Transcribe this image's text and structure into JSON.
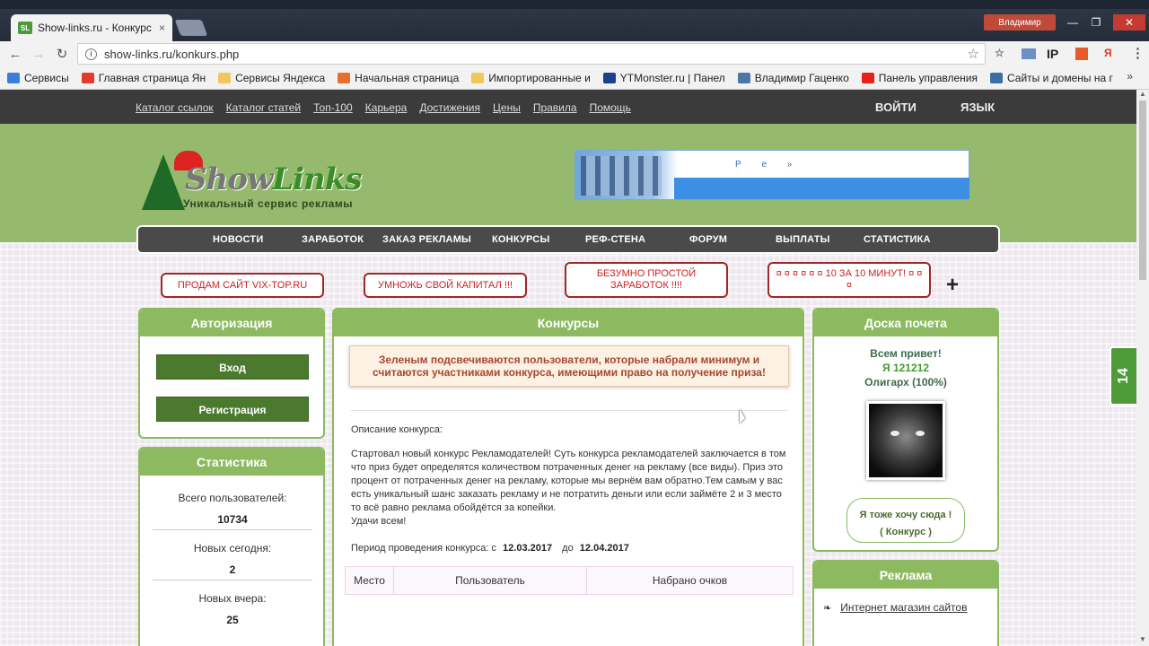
{
  "browser": {
    "tab_title": "Show-links.ru - Конкурс",
    "tab_favicon": "SL",
    "tab_close": "×",
    "user_name": "Владимир",
    "win_min": "—",
    "win_max": "❐",
    "win_close": "✕",
    "url": "show-links.ru/konkurs.php",
    "info_glyph": "i",
    "star_glyph": "☆",
    "back_glyph": "←",
    "forward_glyph": "→",
    "reload_glyph": "↻",
    "ext_ip": "IP",
    "ext_ya": "Я",
    "menu_glyph": "⋮",
    "bookmarks": [
      {
        "label": "Сервисы",
        "icon": "apps-icon",
        "color": "#3b7ddd"
      },
      {
        "label": "Главная страница Ян",
        "icon": "yandex-icon",
        "color": "#e03b2e"
      },
      {
        "label": "Сервисы Яндекса",
        "icon": "folder-icon",
        "color": "#f1c75b"
      },
      {
        "label": "Начальная страница",
        "icon": "firefox-icon",
        "color": "#e4702d"
      },
      {
        "label": "Импортированные и",
        "icon": "folder-icon",
        "color": "#f1c75b"
      },
      {
        "label": "YTMonster.ru | Панел",
        "icon": "ytmonster-icon",
        "color": "#1d3f8f"
      },
      {
        "label": "Владимир Гаценко",
        "icon": "vk-icon",
        "color": "#4a76a8"
      },
      {
        "label": "Панель управления",
        "icon": "youtube-icon",
        "color": "#e62117"
      },
      {
        "label": "Сайты и домены на г",
        "icon": "site-icon",
        "color": "#3a6ea5"
      }
    ],
    "bookmarks_more": "»"
  },
  "topnav": {
    "links": [
      "Каталог ссылок",
      "Каталог статей",
      "Топ-100",
      "Карьера",
      "Достижения",
      "Цены",
      "Правила",
      "Помощь"
    ],
    "login": "ВОЙТИ",
    "language": "ЯЗЫК"
  },
  "logo": {
    "name_a": "Show",
    "name_b": "Links",
    "tagline": "Уникальный сервис рекламы"
  },
  "banner": {
    "text": "Р е »"
  },
  "mainnav": [
    "НОВОСТИ",
    "ЗАРАБОТОК",
    "ЗАКАЗ РЕКЛАМЫ",
    "КОНКУРСЫ",
    "РЕФ-СТЕНА",
    "ФОРУМ",
    "ВЫПЛАТЫ",
    "СТАТИСТИКА"
  ],
  "promos": [
    "ПРОДАМ САЙТ VIX-TOP.RU",
    "УМНОЖЬ СВОЙ КАПИТАЛ !!!",
    "БЕЗУМНО ПРОСТОЙ ЗАРАБОТОК !!!!",
    "¤ ¤ ¤ ¤ ¤ ¤ 10 ЗА 10 МИНУТ! ¤ ¤ ¤"
  ],
  "plus": "+",
  "auth_box": {
    "title": "Авторизация",
    "login": "Вход",
    "register": "Регистрация"
  },
  "stats_box": {
    "title": "Статистика",
    "total_label": "Всего пользователей:",
    "total": "10734",
    "today_label": "Новых сегодня:",
    "today": "2",
    "yesterday_label": "Новых вчера:",
    "yesterday": "25"
  },
  "contest": {
    "title": "Конкурсы",
    "notice": "Зеленым подсвечиваются пользователи, которые набрали минимум и считаются участниками конкурса, имеющими право на получение приза!",
    "desc_label": "Описание конкурса:",
    "desc": "Стартовал новый конкурс Рекламодателей! Суть конкурса рекламодателей заключается в том что приз будет определятся количеством потраченных денег на рекламу (все виды). Приз это процент от потраченных денег на рекламу, которые мы вернём вам обратно.Тем самым у вас есть уникальный шанс заказать рекламу и не потратить деньги или если займёте 2 и 3 место то всё равно реклама обойдётся за копейки.",
    "greeting": "Удачи всем!",
    "period_label": "Период проведения конкурса: с",
    "date_from": "12.03.2017",
    "date_sep": "до",
    "date_to": "12.04.2017",
    "columns": [
      "Место",
      "Пользователь",
      "Набрано очков"
    ]
  },
  "honor_box": {
    "title": "Доска почета",
    "hello": "Всем привет!",
    "user": "Я 121212",
    "rank": "Олигарх (100%)",
    "cta_line1": "Я тоже хочу сюда !",
    "cta_line2": "( Конкурс )"
  },
  "ads_box": {
    "title": "Реклама",
    "item": "Интернет магазин сайтов",
    "item_icon": "❧"
  },
  "side_tab": "14"
}
